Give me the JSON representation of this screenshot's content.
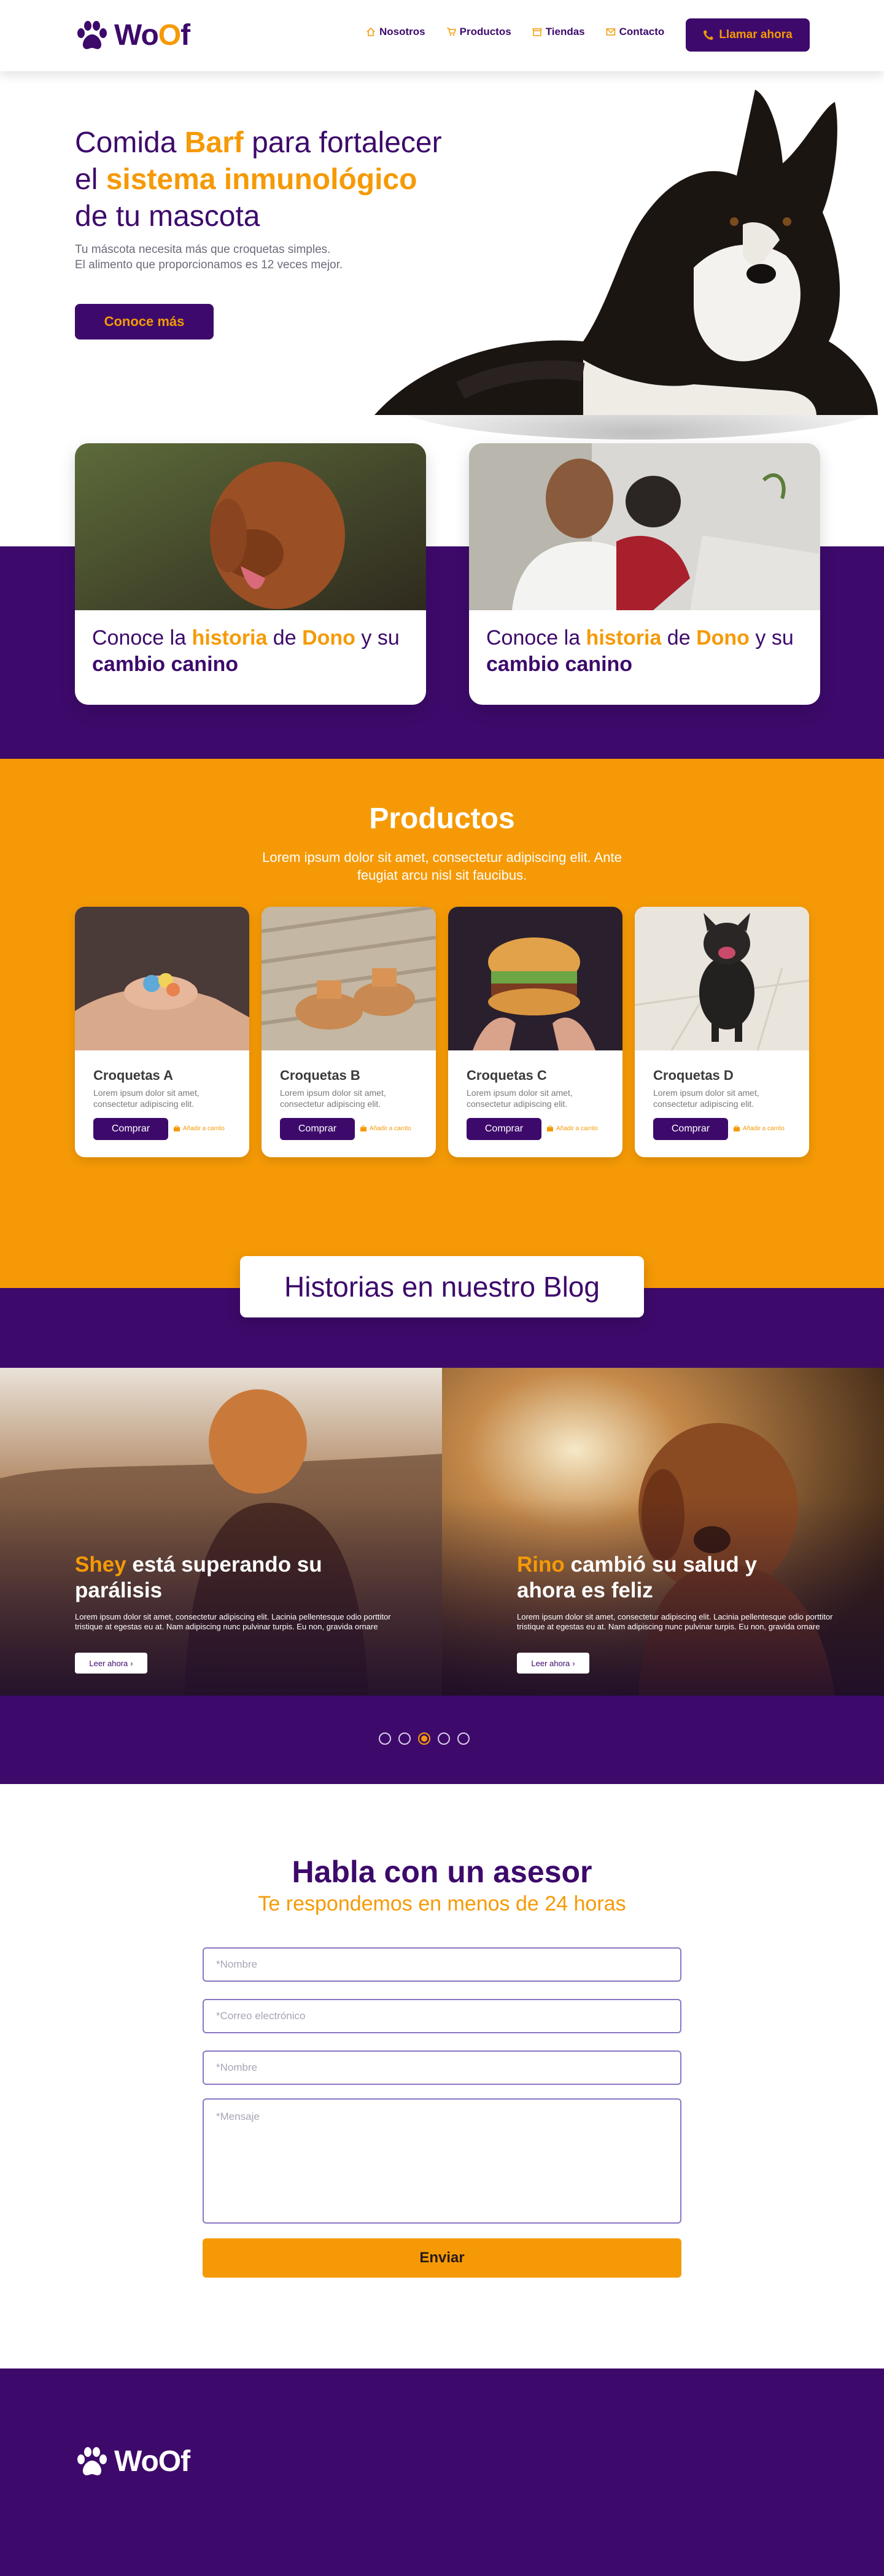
{
  "brand": {
    "name_a": "Wo",
    "name_b": "O",
    "name_c": "f"
  },
  "nav": [
    {
      "label": "Nosotros",
      "icon": "home-icon"
    },
    {
      "label": "Productos",
      "icon": "cart-icon"
    },
    {
      "label": "Tiendas",
      "icon": "store-icon"
    },
    {
      "label": "Contacto",
      "icon": "mail-icon"
    }
  ],
  "call_button": "Llamar ahora",
  "hero": {
    "title_1": "Comida ",
    "title_2": "Barf",
    "title_3": " para fortalecer",
    "title_4": "el ",
    "title_5": "sistema inmunológico",
    "title_6": "de tu mascota",
    "sub_1": "Tu máscota necesita más que croquetas simples.",
    "sub_2": "El alimento que proporcionamos es 12 veces mejor.",
    "button": "Conoce más"
  },
  "stories": [
    {
      "t1": "Conoce la ",
      "t2": "historia",
      "t3": " de ",
      "t4": "Dono",
      "t5": " y su",
      "t6": "cambio canino"
    },
    {
      "t1": "Conoce la ",
      "t2": "historia",
      "t3": " de ",
      "t4": "Dono",
      "t5": " y su",
      "t6": "cambio canino"
    }
  ],
  "products": {
    "title": "Productos",
    "subtitle": "Lorem ipsum dolor sit amet, consectetur adipiscing elit. Ante feugiat arcu nisl sit faucibus.",
    "items": [
      {
        "name": "Croquetas A",
        "desc": "Lorem ipsum dolor sit amet, consectetur adipiscing elit.",
        "buy": "Comprar",
        "add": "Añadir a carrito"
      },
      {
        "name": "Croquetas B",
        "desc": "Lorem ipsum dolor sit amet, consectetur adipiscing elit.",
        "buy": "Comprar",
        "add": "Añadir a carrito"
      },
      {
        "name": "Croquetas C",
        "desc": "Lorem ipsum dolor sit amet, consectetur adipiscing elit.",
        "buy": "Comprar",
        "add": "Añadir a carrito"
      },
      {
        "name": "Croquetas D",
        "desc": "Lorem ipsum dolor sit amet, consectetur adipiscing elit.",
        "buy": "Comprar",
        "add": "Añadir a carrito"
      }
    ]
  },
  "blog": {
    "title": "Historias en nuestro Blog",
    "slides": [
      {
        "name": "Shey",
        "title_rest": " está superando su parálisis",
        "text": "Lorem ipsum dolor sit amet, consectetur adipiscing elit. Lacinia pellentesque odio porttitor tristique at egestas eu at. Nam adipiscing nunc pulvinar turpis. Eu non, gravida ornare",
        "read": "Leer ahora"
      },
      {
        "name": "Rino",
        "title_rest": " cambió su salud y ahora es feliz",
        "text": "Lorem ipsum dolor sit amet, consectetur adipiscing elit. Lacinia pellentesque odio porttitor tristique at egestas eu at. Nam adipiscing nunc pulvinar turpis. Eu non, gravida ornare",
        "read": "Leer ahora"
      }
    ],
    "active_dot": 3,
    "dot_count": 5
  },
  "contact": {
    "title": "Habla con un asesor",
    "subtitle": "Te respondemos en menos de 24 horas",
    "ph_name": "*Nombre",
    "ph_email": "*Correo electrónico",
    "ph_name2": "*Nombre",
    "ph_message": "*Mensaje",
    "send": "Enviar"
  },
  "colors": {
    "primary": "#3d0a6b",
    "accent": "#f59a06"
  }
}
